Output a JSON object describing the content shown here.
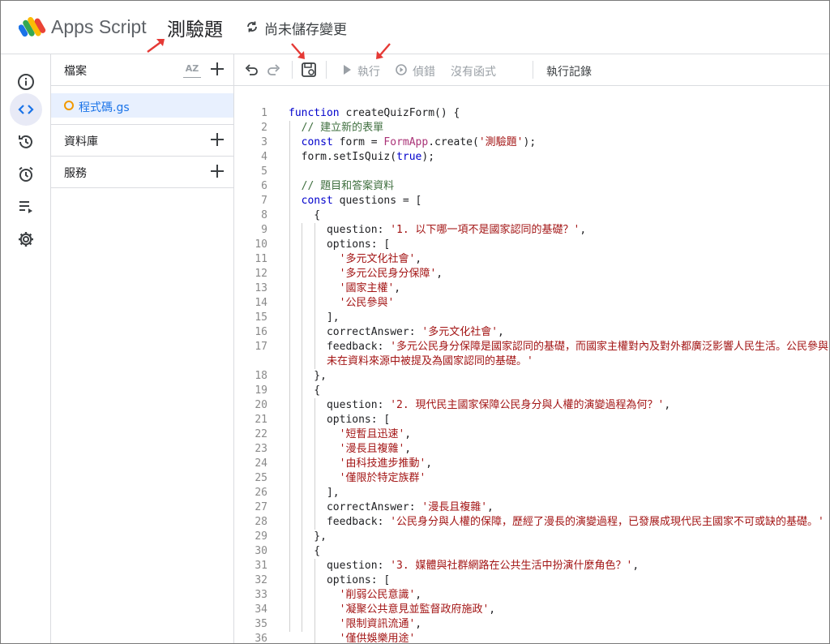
{
  "header": {
    "brand": "Apps Script",
    "project_title": "測驗題",
    "save_status": "尚未儲存變更"
  },
  "sidebar": {
    "files_label": "檔案",
    "file_name": "程式碼.gs",
    "libraries_label": "資料庫",
    "services_label": "服務",
    "sort_label": "AZ"
  },
  "toolbar": {
    "run_label": "執行",
    "debug_label": "偵錯",
    "function_select": "沒有函式",
    "log_label": "執行記錄"
  },
  "colors": {
    "accent": "#1a73e8",
    "keyword": "#0000cc",
    "string": "#a31515",
    "comment": "#3f6f3f",
    "annotation_arrow": "#e53935"
  },
  "code": {
    "lines": [
      {
        "n": "1",
        "tokens": [
          [
            "kw",
            "function "
          ],
          [
            "fn",
            "createQuizForm() {"
          ]
        ]
      },
      {
        "n": "2",
        "tokens": [
          [
            "cm",
            "  // 建立新的表單"
          ]
        ]
      },
      {
        "n": "3",
        "tokens": [
          [
            "kw",
            "  const "
          ],
          [
            "pl",
            "form = "
          ],
          [
            "cls",
            "FormApp"
          ],
          [
            "pl",
            ".create("
          ],
          [
            "st",
            "'測驗題'"
          ],
          [
            "pl",
            ");"
          ]
        ]
      },
      {
        "n": "4",
        "tokens": [
          [
            "pl",
            "  form.setIsQuiz("
          ],
          [
            "bool",
            "true"
          ],
          [
            "pl",
            ");"
          ]
        ]
      },
      {
        "n": "5",
        "tokens": [
          [
            "pl",
            ""
          ]
        ]
      },
      {
        "n": "6",
        "tokens": [
          [
            "cm",
            "  // 題目和答案資料"
          ]
        ]
      },
      {
        "n": "7",
        "tokens": [
          [
            "kw",
            "  const "
          ],
          [
            "pl",
            "questions = ["
          ]
        ]
      },
      {
        "n": "8",
        "tokens": [
          [
            "pl",
            "    {"
          ]
        ]
      },
      {
        "n": "9",
        "tokens": [
          [
            "pl",
            "      question: "
          ],
          [
            "st",
            "'1. 以下哪一項不是國家認同的基礎？'"
          ],
          [
            "pl",
            ","
          ]
        ]
      },
      {
        "n": "10",
        "tokens": [
          [
            "pl",
            "      options: ["
          ]
        ]
      },
      {
        "n": "11",
        "tokens": [
          [
            "st",
            "        '多元文化社會'"
          ],
          [
            "pl",
            ","
          ]
        ]
      },
      {
        "n": "12",
        "tokens": [
          [
            "st",
            "        '多元公民身分保障'"
          ],
          [
            "pl",
            ","
          ]
        ]
      },
      {
        "n": "13",
        "tokens": [
          [
            "st",
            "        '國家主權'"
          ],
          [
            "pl",
            ","
          ]
        ]
      },
      {
        "n": "14",
        "tokens": [
          [
            "st",
            "        '公民參與'"
          ]
        ]
      },
      {
        "n": "15",
        "tokens": [
          [
            "pl",
            "      ],"
          ]
        ]
      },
      {
        "n": "16",
        "tokens": [
          [
            "pl",
            "      correctAnswer: "
          ],
          [
            "st",
            "'多元文化社會'"
          ],
          [
            "pl",
            ","
          ]
        ]
      },
      {
        "n": "17",
        "tokens": [
          [
            "pl",
            "      feedback: "
          ],
          [
            "st",
            "'多元公民身分保障是國家認同的基礎，而國家主權對內及對外都廣泛影響人民生活。公民參與"
          ]
        ]
      },
      {
        "n": "",
        "tokens": [
          [
            "st",
            "      未在資料來源中被提及為國家認同的基礎。'"
          ]
        ]
      },
      {
        "n": "18",
        "tokens": [
          [
            "pl",
            "    },"
          ]
        ]
      },
      {
        "n": "19",
        "tokens": [
          [
            "pl",
            "    {"
          ]
        ]
      },
      {
        "n": "20",
        "tokens": [
          [
            "pl",
            "      question: "
          ],
          [
            "st",
            "'2. 現代民主國家保障公民身分與人權的演變過程為何？'"
          ],
          [
            "pl",
            ","
          ]
        ]
      },
      {
        "n": "21",
        "tokens": [
          [
            "pl",
            "      options: ["
          ]
        ]
      },
      {
        "n": "22",
        "tokens": [
          [
            "st",
            "        '短暫且迅速'"
          ],
          [
            "pl",
            ","
          ]
        ]
      },
      {
        "n": "23",
        "tokens": [
          [
            "st",
            "        '漫長且複雜'"
          ],
          [
            "pl",
            ","
          ]
        ]
      },
      {
        "n": "24",
        "tokens": [
          [
            "st",
            "        '由科技進步推動'"
          ],
          [
            "pl",
            ","
          ]
        ]
      },
      {
        "n": "25",
        "tokens": [
          [
            "st",
            "        '僅限於特定族群'"
          ]
        ]
      },
      {
        "n": "26",
        "tokens": [
          [
            "pl",
            "      ],"
          ]
        ]
      },
      {
        "n": "27",
        "tokens": [
          [
            "pl",
            "      correctAnswer: "
          ],
          [
            "st",
            "'漫長且複雜'"
          ],
          [
            "pl",
            ","
          ]
        ]
      },
      {
        "n": "28",
        "tokens": [
          [
            "pl",
            "      feedback: "
          ],
          [
            "st",
            "'公民身分與人權的保障，歷經了漫長的演變過程，已發展成現代民主國家不可或缺的基礎。'"
          ]
        ]
      },
      {
        "n": "29",
        "tokens": [
          [
            "pl",
            "    },"
          ]
        ]
      },
      {
        "n": "30",
        "tokens": [
          [
            "pl",
            "    {"
          ]
        ]
      },
      {
        "n": "31",
        "tokens": [
          [
            "pl",
            "      question: "
          ],
          [
            "st",
            "'3. 媒體與社群網路在公共生活中扮演什麼角色？'"
          ],
          [
            "pl",
            ","
          ]
        ]
      },
      {
        "n": "32",
        "tokens": [
          [
            "pl",
            "      options: ["
          ]
        ]
      },
      {
        "n": "33",
        "tokens": [
          [
            "st",
            "        '削弱公民意識'"
          ],
          [
            "pl",
            ","
          ]
        ]
      },
      {
        "n": "34",
        "tokens": [
          [
            "st",
            "        '凝聚公共意見並監督政府施政'"
          ],
          [
            "pl",
            ","
          ]
        ]
      },
      {
        "n": "35",
        "tokens": [
          [
            "st",
            "        '限制資訊流通'"
          ],
          [
            "pl",
            ","
          ]
        ]
      },
      {
        "n": "36",
        "tokens": [
          [
            "st",
            "        '僅供娛樂用途'"
          ]
        ]
      }
    ]
  }
}
